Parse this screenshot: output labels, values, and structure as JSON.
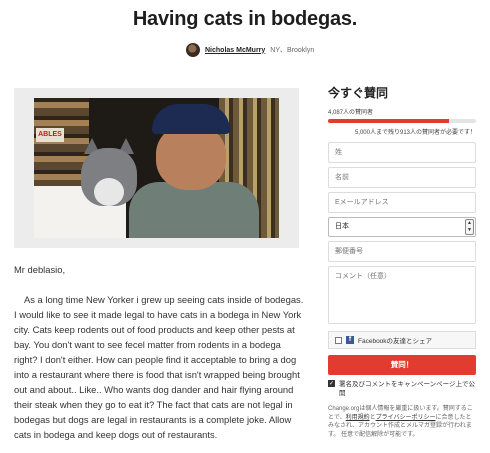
{
  "petition": {
    "title": "Having cats in bodegas.",
    "author_name": "Nicholas McMurry",
    "author_location": "NY、Brooklyn"
  },
  "photo": {
    "sign_text": "ABLES"
  },
  "letter": {
    "greeting": "Mr deblasio,",
    "body": "As a long time New Yorker i grew up seeing cats inside of bodegas. I would like to see it made legal to have cats in a bodega in New York city. Cats keep rodents out of food products and keep other pests at bay. You don't want to see fecel matter from rodents in a bodega right? I don't either. How can people find it acceptable to bring a dog into a restaurant where there is food that isn't wrapped being brought out and about.. Like.. Who wants dog dander and hair flying around their steak when they go to eat it? The fact that cats are not legal in bodegas but dogs are legal in restaurants is a complete joke. Allow cats in bodega and keep dogs out of restaurants."
  },
  "sidebar": {
    "title": "今すぐ賛同",
    "count_text": "4,087人の賛同者",
    "progress": 0.82,
    "goal_text": "5,000人まで残り913人の賛同者が必要です！",
    "fields": {
      "last_name": "姓",
      "first_name": "名前",
      "email": "Eメールアドレス",
      "country": "日本",
      "postal": "郵便番号",
      "comment": "コメント（任意）"
    },
    "facebook_label": "Facebookの友達とシェア",
    "sign_button": "賛同！",
    "consent_text": "署名及びコメントをキャンペーンページ上で公開",
    "legal_prefix": "Change.orgは個人情報を厳重に扱います。賛同することで、",
    "legal_link1": "利用規約",
    "legal_mid": "と",
    "legal_link2": "プライバシーポリシー",
    "legal_suffix": "に合意したとみなされ、アカウント作成とメルマガ登録が行われます。 任意で配信解除が可能です。"
  },
  "colors": {
    "accent": "#e13c2f",
    "facebook": "#3b5998"
  }
}
